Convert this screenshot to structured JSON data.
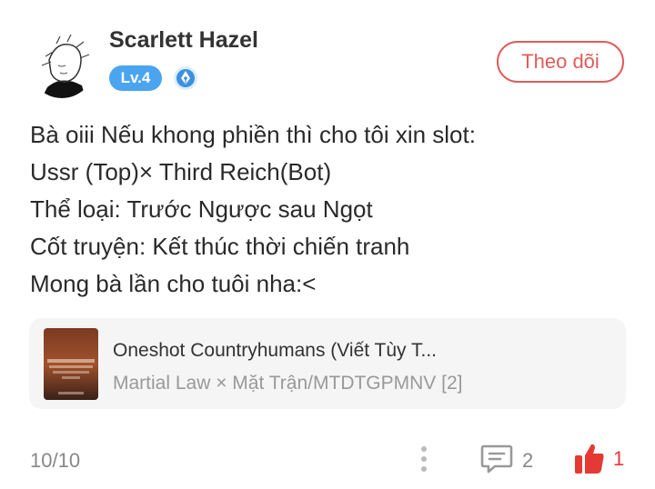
{
  "user": {
    "name": "Scarlett Hazel",
    "level": "Lv.4",
    "follow_label": "Theo dõi"
  },
  "comment": {
    "lines": [
      "Bà oiii Nếu khong phiền thì cho tôi xin slot:",
      "Ussr (Top)× Third Reich(Bot)",
      "Thể loại: Trước Ngược sau Ngọt",
      "Cốt truyện: Kết thúc thời chiến tranh",
      "Mong bà lần cho tuôi nha:<"
    ]
  },
  "story": {
    "title": "Oneshot Countryhumans (Viết Tùy T...",
    "subtitle": "Martial Law × Mặt Trận/MTDTGPMNV [2]"
  },
  "footer": {
    "page": "10/10",
    "comment_count": "2",
    "like_count": "1"
  },
  "colors": {
    "accent_red": "#e05b5b",
    "level_blue": "#4ba4f0",
    "text_gray": "#999999"
  },
  "icons": {
    "avatar": "anime-avatar",
    "badge": "pen-nib-icon",
    "more": "more-vertical-icon",
    "comment": "comment-icon",
    "like": "thumbs-up-icon"
  }
}
